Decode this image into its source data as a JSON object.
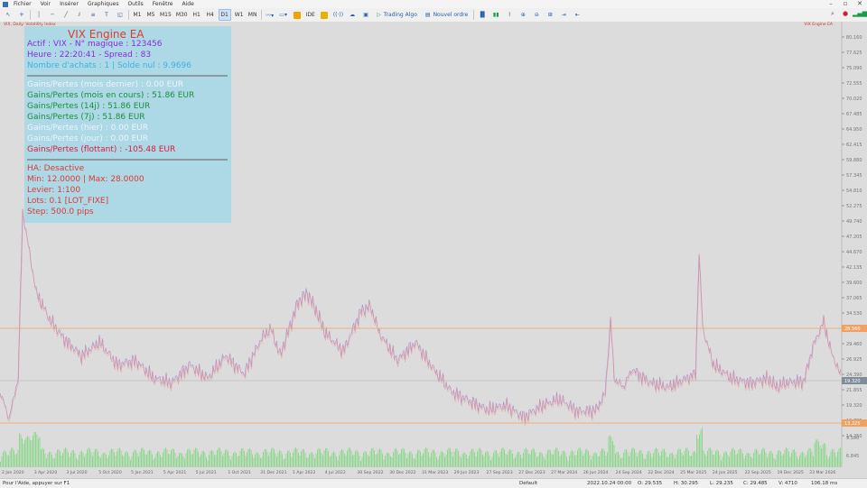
{
  "menu": [
    "Fichier",
    "Voir",
    "Insérer",
    "Graphiques",
    "Outils",
    "Fenêtre",
    "Aide"
  ],
  "toolbar": {
    "timeframes": [
      "M1",
      "M5",
      "M15",
      "M30",
      "H1",
      "H4",
      "D1",
      "W1",
      "MN"
    ],
    "active_timeframe": "D1",
    "ide": "IDE",
    "trading_algo": "Trading Algo",
    "new_order": "Nouvel ordre"
  },
  "chart": {
    "symbol_label": "VIX, Daily:",
    "symbol_desc": "Volatility Index",
    "ea_label": "VIX Engine EA",
    "price_ticks": [
      "80.160",
      "77.625",
      "75.090",
      "72.555",
      "70.020",
      "67.485",
      "64.950",
      "62.415",
      "59.880",
      "57.345",
      "54.810",
      "52.275",
      "49.740",
      "47.205",
      "44.670",
      "42.135",
      "39.600",
      "37.065",
      "34.530",
      "31.995",
      "29.460",
      "26.925",
      "24.390",
      "21.855",
      "19.320",
      "16.785",
      "14.250"
    ],
    "price_line_label": "28.560",
    "current_price_label": "19.320",
    "volume_line_label": "13.225",
    "volume_ticks": [
      "9.180",
      "6.845"
    ],
    "date_ticks": [
      "2 Jan 2020",
      "3 Apr 2020",
      "3 Jul 2020",
      "5 Oct 2020",
      "5 Jan 2021",
      "5 Apr 2021",
      "5 Jul 2021",
      "1 Oct 2021",
      "31 Dec 2021",
      "1 Apr 2022",
      "4 Jul 2022",
      "30 Sep 2022",
      "30 Dec 2022",
      "31 Mar 2023",
      "29 Jun 2023",
      "27 Sep 2023",
      "27 Dec 2023",
      "27 Mar 2024",
      "26 Jun 2024",
      "24 Sep 2024",
      "22 Dec 2024",
      "25 Mar 2025",
      "24 Jun 2025",
      "22 Sep 2025",
      "19 Dec 2025",
      "23 Mar 2026"
    ]
  },
  "panel": {
    "title": "VIX Engine EA",
    "line1": "Actif : VIX  -  N° magique : 123456",
    "line2": "Heure : 22:20:41  -  Spread : 83",
    "line3": "Nombre d'achats : 1  |  Solde nul : 9.9696",
    "gain_last_month": "Gains/Pertes (mois dernier) : 0.00 EUR",
    "gain_month": "Gains/Pertes (mois en cours) : 51.86 EUR",
    "gain_14d": "Gains/Pertes (14j) : 51.86 EUR",
    "gain_7d": "Gains/Pertes (7j) : 51.86 EUR",
    "gain_yesterday": "Gains/Pertes (hier) : 0.00 EUR",
    "gain_today": "Gains/Pertes (jour) : 0.00 EUR",
    "gain_floating": "Gains/Pertes (flottant) : -105.48 EUR",
    "ha": "HA: Desactive",
    "minmax": "Min: 12.0000 | Max: 28.0000",
    "leverage": "Levier: 1:100",
    "lots": "Lots: 0.1 [LOT_FIXE]",
    "step": "Step: 500.0 pips",
    "colors": {
      "title": "#e03a2f",
      "header": "#8a2be2",
      "info": "#3fb0e8",
      "muted": "#e8f2f8",
      "green": "#1a8f3a",
      "red": "#d81e3a",
      "settings": "#e03a2f"
    }
  },
  "status": {
    "help": "Pour l'Aide, appuyer sur F1",
    "profile": "Default",
    "datetime": "2022.10.24 00:00",
    "open": "O: 29.535",
    "high": "H: 30.295",
    "low": "L: 29.235",
    "close": "C: 29.485",
    "volume": "V: 4710",
    "ping": "106.18 ms"
  }
}
